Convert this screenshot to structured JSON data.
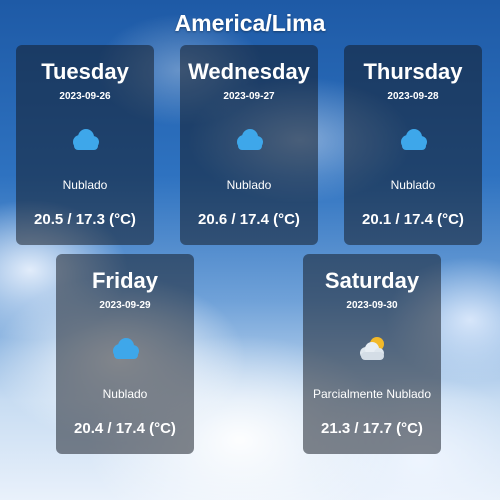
{
  "location": "America/Lima",
  "forecast": [
    {
      "day": "Tuesday",
      "date": "2023-09-26",
      "condition": "Nublado",
      "temps": "20.5 / 17.3 (°C)",
      "icon": "cloudy-icon"
    },
    {
      "day": "Wednesday",
      "date": "2023-09-27",
      "condition": "Nublado",
      "temps": "20.6 / 17.4 (°C)",
      "icon": "cloudy-icon"
    },
    {
      "day": "Thursday",
      "date": "2023-09-28",
      "condition": "Nublado",
      "temps": "20.1 / 17.4 (°C)",
      "icon": "cloudy-icon"
    },
    {
      "day": "Friday",
      "date": "2023-09-29",
      "condition": "Nublado",
      "temps": "20.4 / 17.4 (°C)",
      "icon": "cloudy-icon"
    },
    {
      "day": "Saturday",
      "date": "2023-09-30",
      "condition": "Parcialmente Nublado",
      "temps": "21.3 / 17.7 (°C)",
      "icon": "partly-cloudy-icon"
    }
  ],
  "colors": {
    "cloud_icon": "#3ea7ea",
    "sun": "#f3b929",
    "card_background": "rgba(20,25,35,0.52)"
  }
}
